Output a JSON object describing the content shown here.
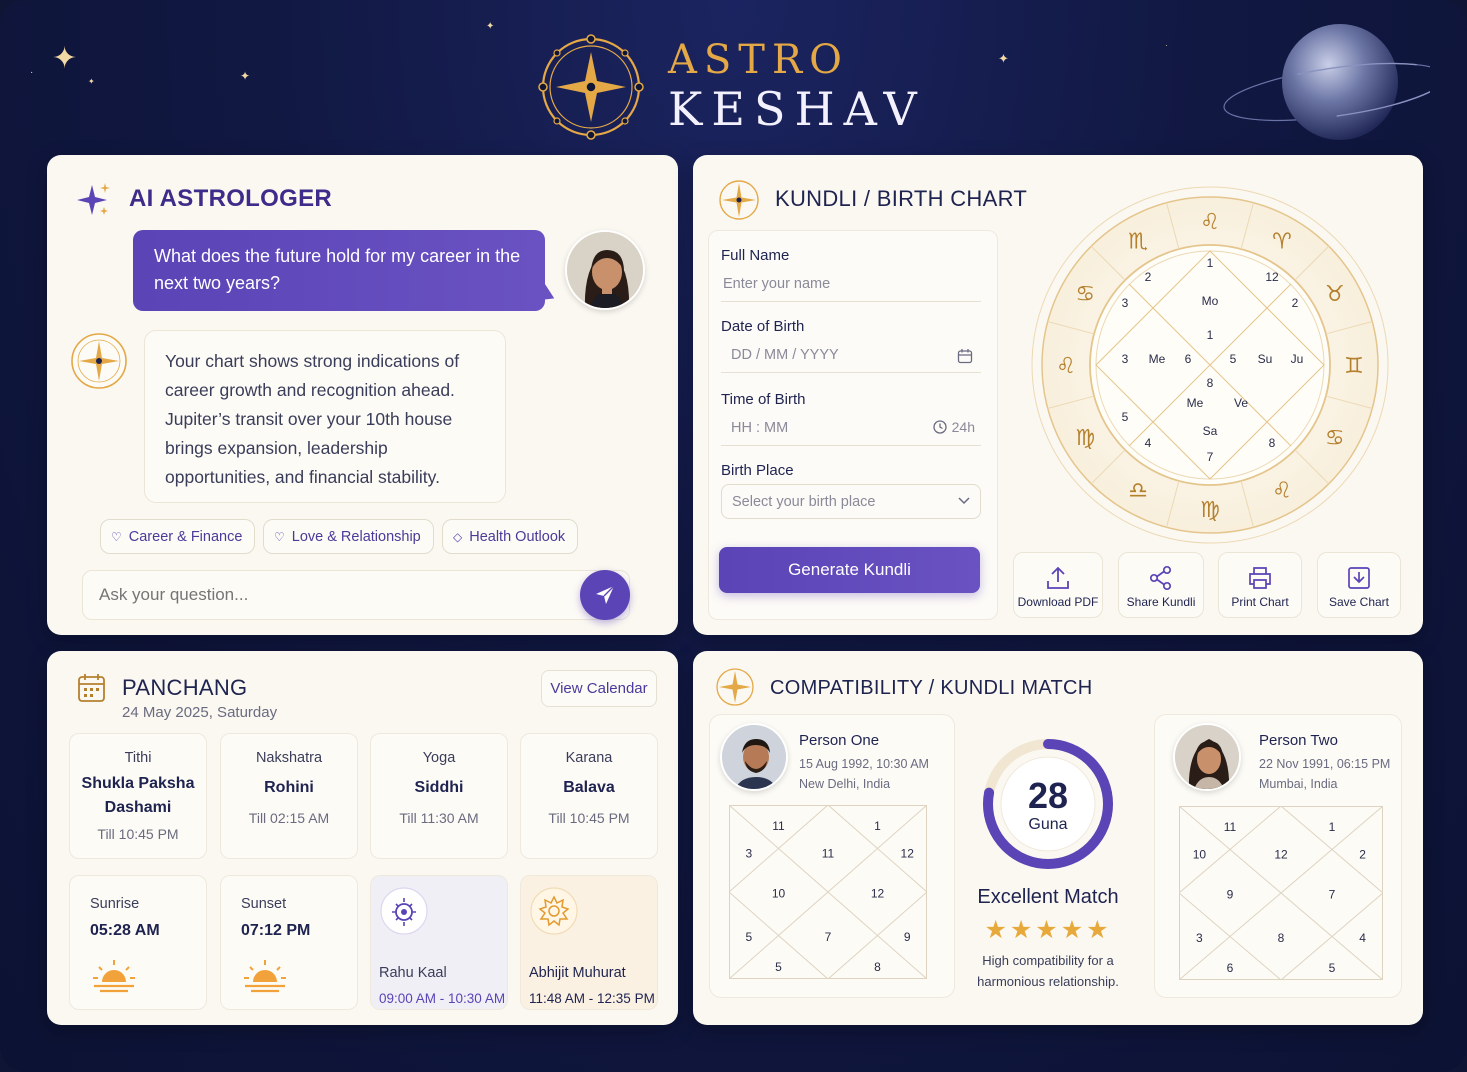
{
  "brand": {
    "line1": "ASTRO",
    "line2": "KESHAV"
  },
  "ai": {
    "title": "AI ASTROLOGER",
    "user_message": "What does the future hold for my career in the next two years?",
    "ai_message": "Your chart shows strong indications of career growth and recognition ahead. Jupiter’s transit over your 10th house brings expansion, leadership opportunities, and financial stability.",
    "chips": [
      "Career & Finance",
      "Love & Relationship",
      "Health Outlook"
    ],
    "ask_placeholder": "Ask your question..."
  },
  "kundli": {
    "title": "KUNDLI / BIRTH CHART",
    "full_name_label": "Full Name",
    "full_name_placeholder": "Enter your name",
    "dob_label": "Date of Birth",
    "dob_placeholder": "DD / MM / YYYY",
    "tob_label": "Time of Birth",
    "tob_placeholder": "HH : MM",
    "tob_format": "24h",
    "place_label": "Birth Place",
    "place_placeholder": "Select your birth place",
    "generate_label": "Generate Kundli",
    "actions": [
      "Download PDF",
      "Share Kundli",
      "Print Chart",
      "Save Chart"
    ],
    "zodiac_glyphs": [
      "♈",
      "♉",
      "♊",
      "♋",
      "♌",
      "♍",
      "♎",
      "♍",
      "♌",
      "♋",
      "♏",
      "♌"
    ],
    "chart_numbers": [
      "1",
      "12",
      "2",
      "2",
      "3",
      "1",
      "3",
      "6",
      "5",
      "8",
      "5",
      "4",
      "7",
      "8"
    ],
    "chart_planets": [
      "Mo",
      "Me",
      "Su",
      "Ju",
      "Me",
      "Ve",
      "Sa"
    ]
  },
  "panchang": {
    "title": "PANCHANG",
    "date": "24 May 2025, Saturday",
    "view_calendar": "View Calendar",
    "items": [
      {
        "label": "Tithi",
        "value": "Shukla Paksha Dashami",
        "till": "Till 10:45 PM"
      },
      {
        "label": "Nakshatra",
        "value": "Rohini",
        "till": "Till 02:15 AM"
      },
      {
        "label": "Yoga",
        "value": "Siddhi",
        "till": "Till 11:30 AM"
      },
      {
        "label": "Karana",
        "value": "Balava",
        "till": "Till 10:45 PM"
      }
    ],
    "sunrise_label": "Sunrise",
    "sunrise": "05:28 AM",
    "sunset_label": "Sunset",
    "sunset": "07:12 PM",
    "rahu_label": "Rahu Kaal",
    "rahu_time": "09:00 AM - 10:30 AM",
    "abhijit_label": "Abhijit Muhurat",
    "abhijit_time": "11:48 AM - 12:35 PM"
  },
  "compat": {
    "title": "COMPATIBILITY / KUNDLI MATCH",
    "person1": {
      "name": "Person One",
      "dob": "15 Aug 1992, 10:30 AM",
      "place": "New Delhi, India",
      "grid": [
        "11",
        "1",
        "3",
        "11",
        "12",
        "10",
        "12",
        "5",
        "7",
        "9",
        "5",
        "8"
      ]
    },
    "person2": {
      "name": "Person Two",
      "dob": "22 Nov 1991, 06:15 PM",
      "place": "Mumbai, India",
      "grid": [
        "11",
        "1",
        "10",
        "12",
        "2",
        "9",
        "7",
        "3",
        "8",
        "4",
        "6",
        "5"
      ]
    },
    "score": "28",
    "score_unit": "Guna",
    "score_fraction": 0.78,
    "match_label": "Excellent Match",
    "stars": "★★★★★",
    "description": "High compatibility for a harmonious relationship."
  },
  "colors": {
    "accent": "#5a44b6",
    "gold": "#e4a847",
    "navy": "#111842"
  }
}
